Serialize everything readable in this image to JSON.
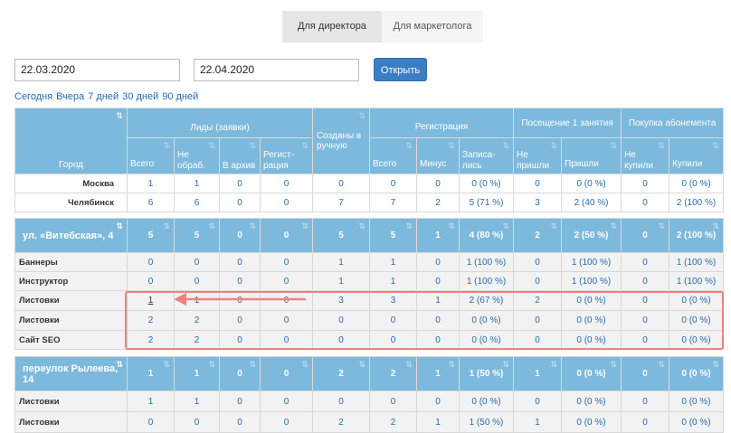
{
  "tabs": [
    {
      "label": "Для директора",
      "active": true
    },
    {
      "label": "Для маркетолога",
      "active": false
    }
  ],
  "filters": {
    "date_from": "22.03.2020",
    "date_to": "22.04.2020",
    "open_label": "Открыть",
    "quick_ranges": [
      "Сегодня",
      "Вчера",
      "7 дней",
      "30 дней",
      "90 дней"
    ]
  },
  "header": {
    "city": "Город",
    "leads_group": "Лиды (заявки)",
    "leads_total": "Всего",
    "leads_unprocessed": "Не обраб.",
    "leads_archive": "В архив",
    "leads_registration": "Регист-рация",
    "created_manually": "Созданы в ручную",
    "reg_group": "Регистрация",
    "reg_total": "Всего",
    "reg_minus": "Минус",
    "reg_enrolled": "Записа-лись",
    "visit_group": "Посещение 1 занятия",
    "visit_no": "Не пришли",
    "visit_yes": "Пришли",
    "buy_group": "Покупка абонемента",
    "buy_no": "Не купили",
    "buy_yes": "Купили"
  },
  "cities": [
    {
      "name": "Москва",
      "values": [
        "1",
        "1",
        "0",
        "0",
        "0",
        "0",
        "0",
        "0 (0 %)",
        "0",
        "0 (0 %)",
        "0",
        "0 (0 %)"
      ]
    },
    {
      "name": "Челябинск",
      "values": [
        "6",
        "6",
        "0",
        "0",
        "7",
        "7",
        "2",
        "5 (71 %)",
        "3",
        "2 (40 %)",
        "0",
        "2 (100 %)"
      ]
    }
  ],
  "groups": [
    {
      "name": "ул. «Витебская», 4",
      "values": [
        "5",
        "5",
        "0",
        "0",
        "5",
        "5",
        "1",
        "4 (80 %)",
        "2",
        "2 (50 %)",
        "0",
        "2 (100 %)"
      ],
      "rows": [
        {
          "source": "Баннеры",
          "values": [
            "0",
            "0",
            "0",
            "0",
            "1",
            "1",
            "0",
            "1 (100 %)",
            "0",
            "1 (100 %)",
            "0",
            "1 (100 %)"
          ]
        },
        {
          "source": "Инструктор",
          "values": [
            "0",
            "0",
            "0",
            "0",
            "1",
            "1",
            "0",
            "1 (100 %)",
            "0",
            "1 (100 %)",
            "0",
            "1 (100 %)"
          ]
        },
        {
          "source": "Листовки",
          "values": [
            "1",
            "1",
            "0",
            "0",
            "3",
            "3",
            "1",
            "2 (67 %)",
            "2",
            "0 (0 %)",
            "0",
            "0 (0 %)"
          ]
        },
        {
          "source": "Листовки",
          "values": [
            "2",
            "2",
            "0",
            "0",
            "0",
            "0",
            "0",
            "0 (0 %)",
            "0",
            "0 (0 %)",
            "0",
            "0 (0 %)"
          ]
        },
        {
          "source": "Сайт SEO",
          "values": [
            "2",
            "2",
            "0",
            "0",
            "0",
            "0",
            "0",
            "0 (0 %)",
            "0",
            "0 (0 %)",
            "0",
            "0 (0 %)"
          ]
        }
      ]
    },
    {
      "name": "переулок Рылеева, 14",
      "values": [
        "1",
        "1",
        "0",
        "0",
        "2",
        "2",
        "1",
        "1 (50 %)",
        "1",
        "0 (0 %)",
        "0",
        "0 (0 %)"
      ],
      "rows": [
        {
          "source": "Листовки",
          "values": [
            "1",
            "1",
            "0",
            "0",
            "0",
            "0",
            "0",
            "0 (0 %)",
            "0",
            "0 (0 %)",
            "0",
            "0 (0 %)"
          ]
        },
        {
          "source": "Листовки",
          "values": [
            "0",
            "0",
            "0",
            "0",
            "2",
            "2",
            "1",
            "1 (50 %)",
            "1",
            "0 (0 %)",
            "0",
            "0 (0 %)"
          ]
        }
      ]
    }
  ],
  "icons": {
    "sort": "sort-icon"
  },
  "colors": {
    "header_bg": "#7db9dc",
    "link": "#2a6bb0",
    "button": "#3a7fc6",
    "highlight": "#f08080"
  }
}
